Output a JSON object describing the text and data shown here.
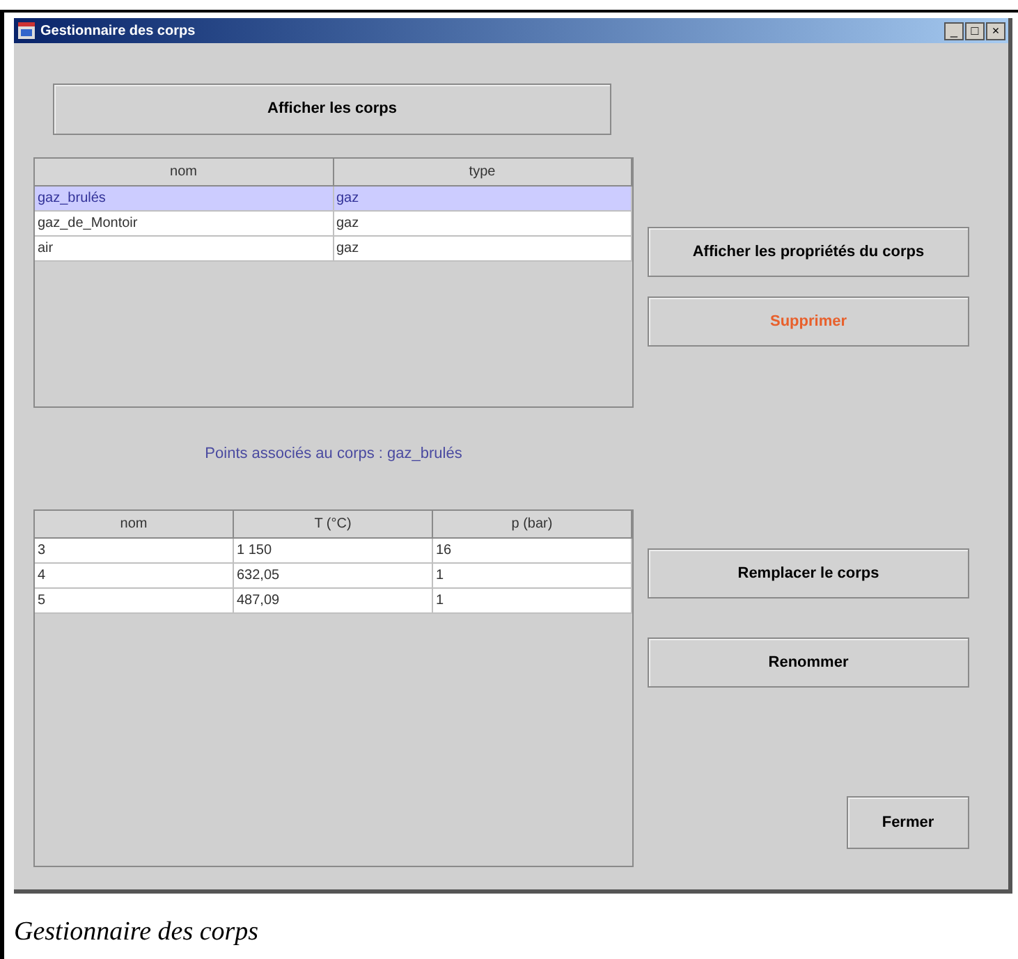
{
  "window": {
    "title": "Gestionnaire des corps",
    "controls": [
      "_",
      "□",
      "×"
    ]
  },
  "show_button": "Afficher les corps",
  "bodies_table": {
    "columns": [
      "nom",
      "type"
    ],
    "rows": [
      {
        "cells": [
          "gaz_brulés",
          "gaz"
        ],
        "selected": true
      },
      {
        "cells": [
          "gaz_de_Montoir",
          "gaz"
        ],
        "selected": false
      },
      {
        "cells": [
          "air",
          "gaz"
        ],
        "selected": false
      }
    ]
  },
  "points_label": "Points associés au corps : gaz_brulés",
  "points_table": {
    "columns": [
      "nom",
      "T (°C)",
      "p (bar)"
    ],
    "rows": [
      {
        "cells": [
          "3",
          "1 150",
          "16"
        ],
        "selected": false
      },
      {
        "cells": [
          "4",
          "632,05",
          "1"
        ],
        "selected": false
      },
      {
        "cells": [
          "5",
          "487,09",
          "1"
        ],
        "selected": false
      }
    ]
  },
  "side_buttons": [
    {
      "label": "Afficher les propriétés du corps",
      "kind": "normal"
    },
    {
      "label": "Supprimer",
      "kind": "danger"
    },
    {
      "label": "Remplacer le corps",
      "kind": "normal"
    },
    {
      "label": "Renommer",
      "kind": "normal"
    }
  ],
  "close_button": "Fermer",
  "caption": "Gestionnaire des corps"
}
